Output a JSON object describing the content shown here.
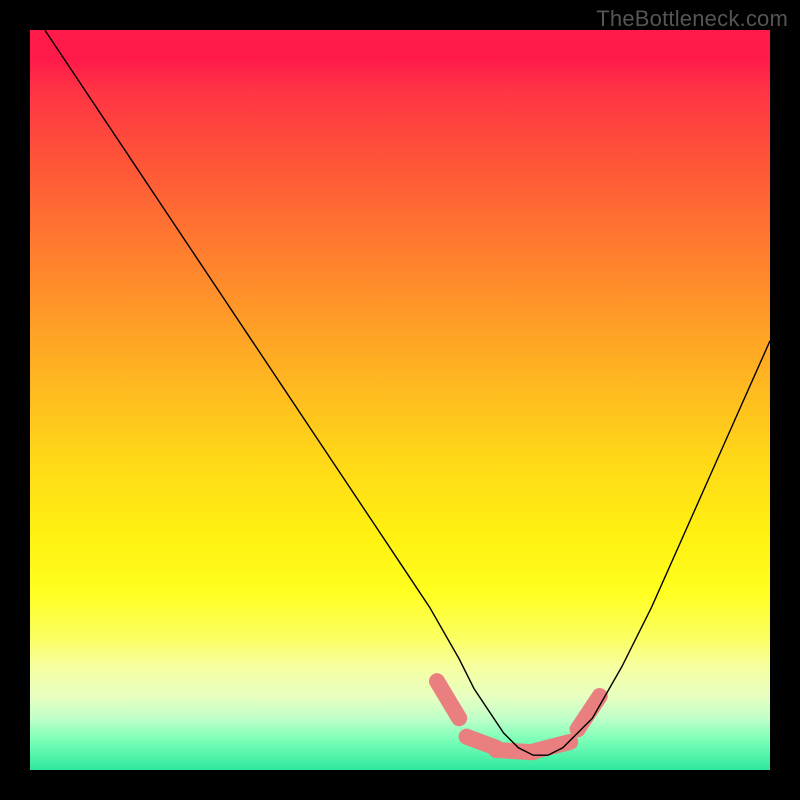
{
  "watermark": "TheBottleneck.com",
  "chart_data": {
    "type": "line",
    "title": "",
    "xlabel": "",
    "ylabel": "",
    "xlim": [
      0,
      100
    ],
    "ylim": [
      0,
      100
    ],
    "series": [
      {
        "name": "bottleneck-curve",
        "x": [
          2,
          6,
          10,
          14,
          18,
          22,
          26,
          30,
          34,
          38,
          42,
          46,
          50,
          54,
          58,
          60,
          62,
          64,
          66,
          68,
          70,
          72,
          76,
          80,
          84,
          88,
          92,
          96,
          100
        ],
        "y": [
          100,
          94,
          88,
          82,
          76,
          70,
          64,
          58,
          52,
          46,
          40,
          34,
          28,
          22,
          15,
          11,
          8,
          5,
          3,
          2,
          2,
          3,
          7,
          14,
          22,
          31,
          40,
          49,
          58
        ]
      }
    ],
    "markers": {
      "name": "highlight-segments",
      "color": "#e97f7e",
      "segments": [
        {
          "x1": 55,
          "y1": 12,
          "x2": 58,
          "y2": 7
        },
        {
          "x1": 59,
          "y1": 4.5,
          "x2": 63,
          "y2": 3
        },
        {
          "x1": 63,
          "y1": 2.7,
          "x2": 68,
          "y2": 2.4
        },
        {
          "x1": 68,
          "y1": 2.5,
          "x2": 73,
          "y2": 3.8
        },
        {
          "x1": 74,
          "y1": 5.5,
          "x2": 77,
          "y2": 10
        }
      ]
    }
  }
}
